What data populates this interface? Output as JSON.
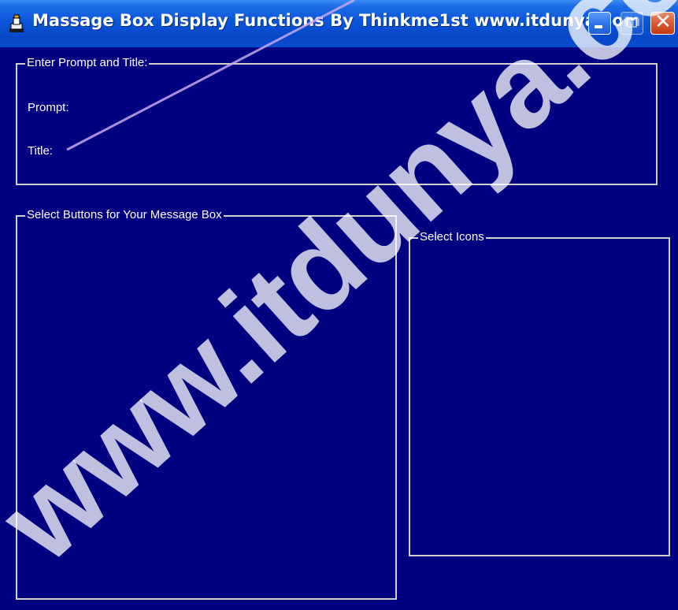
{
  "window": {
    "title": "Massage Box Display Functions  By Thinkme1st www.itdunya.com",
    "icon": "app-icon",
    "controls": [
      "minimize-icon",
      "maximize-icon",
      "close-icon"
    ]
  },
  "groups": {
    "prompt_title": {
      "label": "Enter Prompt and Title:",
      "prompt_label": "Prompt:",
      "title_label": "Title:"
    },
    "buttons": {
      "label": "Select Buttons for Your Message Box"
    },
    "icons": {
      "label": "Select Icons"
    }
  },
  "watermark": {
    "text": "www.itdunya.com"
  },
  "colors": {
    "background": "#000080",
    "titlebar": "#0a55d8",
    "group_border": "#d4d0c8",
    "text": "#ffffff",
    "close_button": "#d9532e"
  }
}
